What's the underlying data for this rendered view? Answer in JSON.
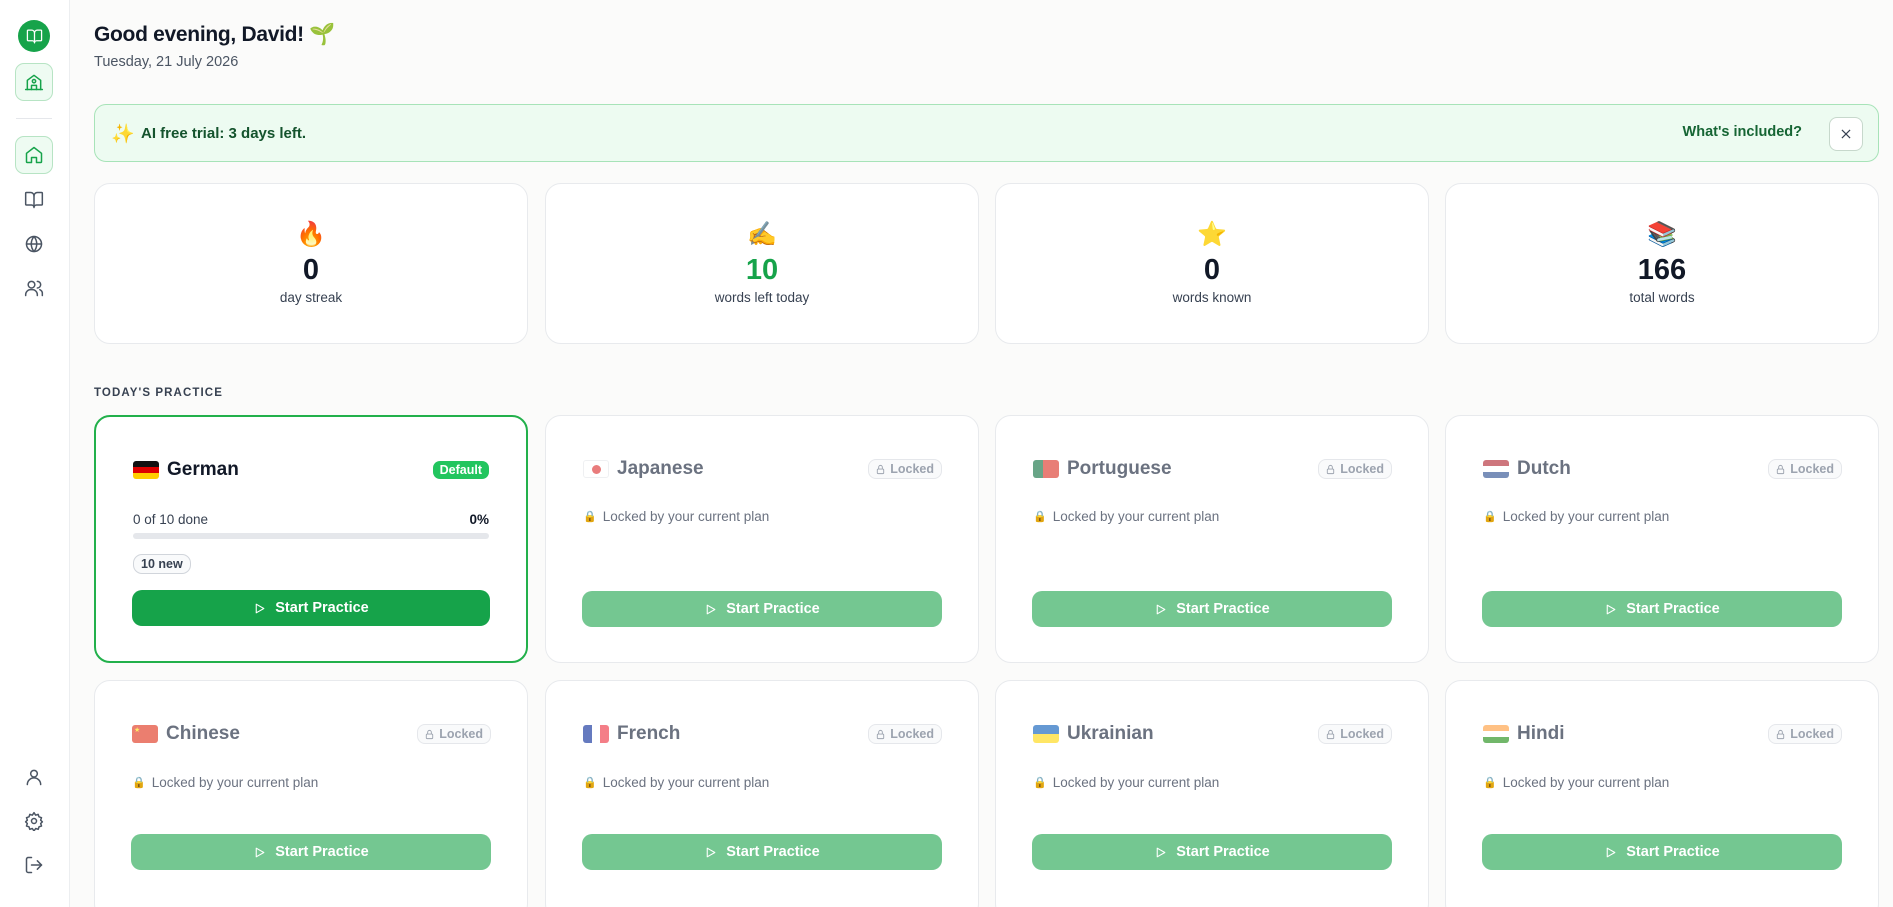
{
  "header": {
    "greeting": "Good evening, David! 🌱",
    "date": "Tuesday, 21 July 2026"
  },
  "banner": {
    "icon": "sparkles-icon",
    "text": "AI free trial: 3 days left.",
    "link": "What's included?"
  },
  "stats": [
    {
      "icon": "🔥",
      "value": "0",
      "label": "day streak"
    },
    {
      "icon": "✍️",
      "value": "10",
      "label": "words left today"
    },
    {
      "icon": "⭐",
      "value": "0",
      "label": "words known"
    },
    {
      "icon": "📚",
      "value": "166",
      "label": "total words"
    }
  ],
  "section_title": "TODAY'S PRACTICE",
  "active_card": {
    "name": "German",
    "badge": "Default",
    "progress_label": "0 of 10 done",
    "progress_pct": "0%",
    "progress_fraction": 0,
    "new_label": "10 new",
    "button": "Start Practice"
  },
  "locked_cards": [
    {
      "name": "Japanese",
      "badge": "Locked",
      "message": "Locked by your current plan",
      "button": "Start Practice"
    },
    {
      "name": "Portuguese",
      "badge": "Locked",
      "message": "Locked by your current plan",
      "button": "Start Practice"
    },
    {
      "name": "Dutch",
      "badge": "Locked",
      "message": "Locked by your current plan",
      "button": "Start Practice"
    },
    {
      "name": "Chinese",
      "badge": "Locked",
      "message": "Locked by your current plan",
      "button": "Start Practice"
    },
    {
      "name": "French",
      "badge": "Locked",
      "message": "Locked by your current plan",
      "button": "Start Practice"
    },
    {
      "name": "Ukrainian",
      "badge": "Locked",
      "message": "Locked by your current plan",
      "button": "Start Practice"
    },
    {
      "name": "Hindi",
      "badge": "Locked",
      "message": "Locked by your current plan",
      "button": "Start Practice"
    }
  ],
  "colors": {
    "accent": "#16a34a",
    "button_disabled": "#74c791",
    "banner_bg": "#edfbf1"
  }
}
